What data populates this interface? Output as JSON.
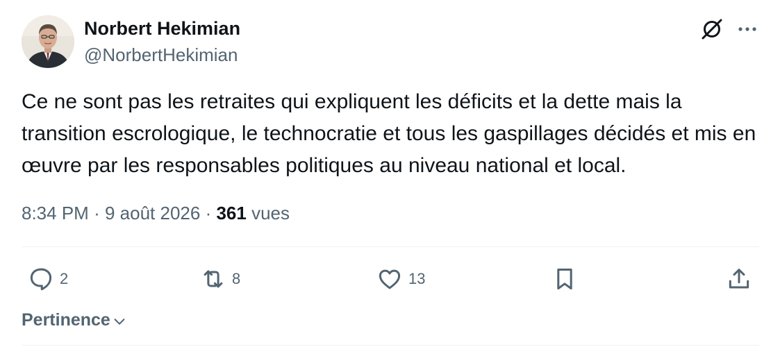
{
  "author": {
    "display_name": "Norbert Hekimian",
    "handle": "@NorbertHekimian",
    "avatar_icon": "profile-photo"
  },
  "header_actions": {
    "grok_icon": "slashed-circle-icon",
    "more_icon": "ellipsis-icon"
  },
  "tweet": {
    "text": "Ce ne sont pas les retraites qui expliquent les déficits et la dette mais la transition escrologique, le technocratie et tous les gaspillages décidés et mis en œuvre par les responsables politiques au niveau national et local.",
    "time": "8:34 PM",
    "separator": "·",
    "date": "9 août 2026",
    "views_count": "361",
    "views_label": "vues"
  },
  "actions": {
    "replies": "2",
    "retweets": "8",
    "likes": "13"
  },
  "sort": {
    "label": "Pertinence"
  },
  "colors": {
    "text_primary": "#0f1419",
    "text_secondary": "#536471",
    "divider": "#eff3f4"
  }
}
